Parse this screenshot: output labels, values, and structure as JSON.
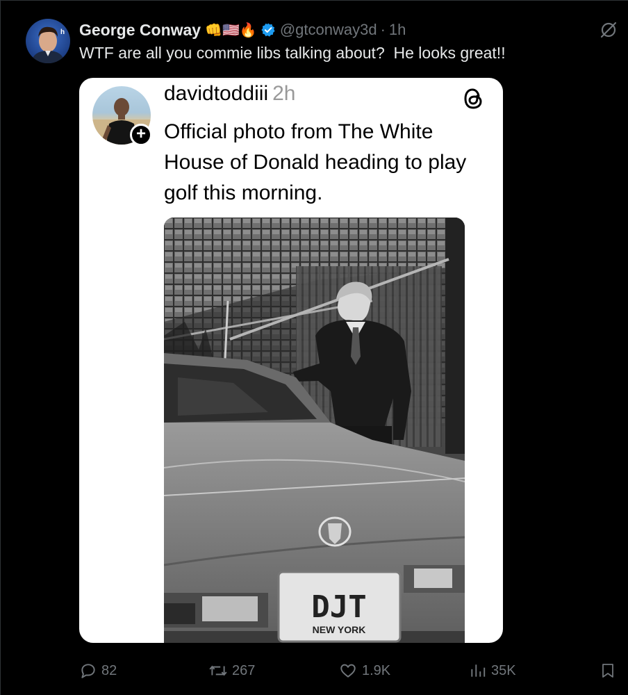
{
  "tweet": {
    "author_name": "George Conway",
    "author_emoji": "👊🇺🇸🔥",
    "handle": "@gtconway3d",
    "separator": "·",
    "time": "1h",
    "text": "WTF are all you commie libs talking about?  He looks great!!"
  },
  "quoted_post": {
    "username": "davidtoddiii",
    "time": "2h",
    "text": "Official photo from The White House of Donald heading to play golf this morning.",
    "photo": {
      "plate_text": "DJT",
      "plate_state": "NEW YORK"
    }
  },
  "actions": {
    "replies": "82",
    "reposts": "267",
    "likes": "1.9K",
    "views": "35K"
  },
  "colors": {
    "background": "#000000",
    "text_primary": "#e7e9ea",
    "text_secondary": "#71767b",
    "verified": "#1d9bf0",
    "card_background": "#ffffff"
  },
  "icons": [
    "verified-badge-icon",
    "grok-icon",
    "threads-icon",
    "plus-icon",
    "reply-icon",
    "repost-icon",
    "like-icon",
    "views-icon",
    "bookmark-icon"
  ]
}
